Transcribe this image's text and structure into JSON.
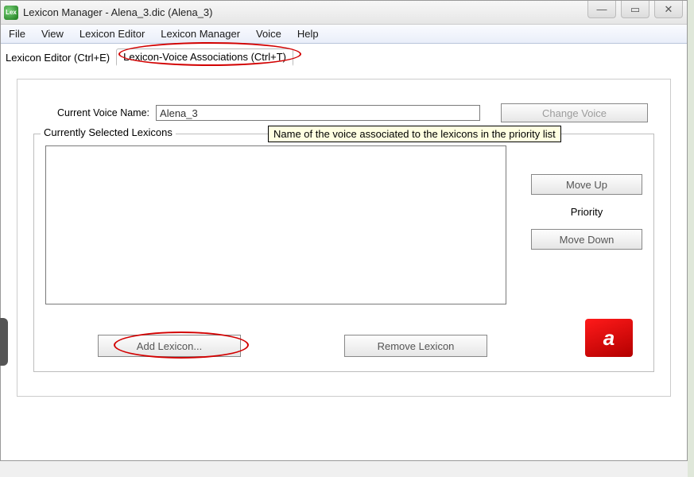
{
  "window": {
    "title": "Lexicon Manager - Alena_3.dic (Alena_3)"
  },
  "winControls": {
    "minimize": "—",
    "maximize": "▭",
    "close": "✕"
  },
  "menu": {
    "file": "File",
    "view": "View",
    "lexiconEditor": "Lexicon Editor",
    "lexiconManager": "Lexicon Manager",
    "voice": "Voice",
    "help": "Help"
  },
  "tabs": {
    "editor": "Lexicon Editor (Ctrl+E)",
    "voiceAssoc": "Lexicon-Voice Associations (Ctrl+T)"
  },
  "form": {
    "currentVoiceLabel": "Current Voice Name:",
    "currentVoiceValue": "Alena_3",
    "changeVoice": "Change Voice"
  },
  "tooltip": {
    "voiceName": "Name of the voice associated to the lexicons in the priority list"
  },
  "group": {
    "legend": "Currently Selected Lexicons",
    "moveUp": "Move Up",
    "priorityLabel": "Priority",
    "moveDown": "Move Down",
    "addLexicon": "Add Lexicon...",
    "removeLexicon": "Remove Lexicon"
  },
  "logo": {
    "glyph": "a"
  },
  "appIcon": {
    "label": "Lex"
  }
}
